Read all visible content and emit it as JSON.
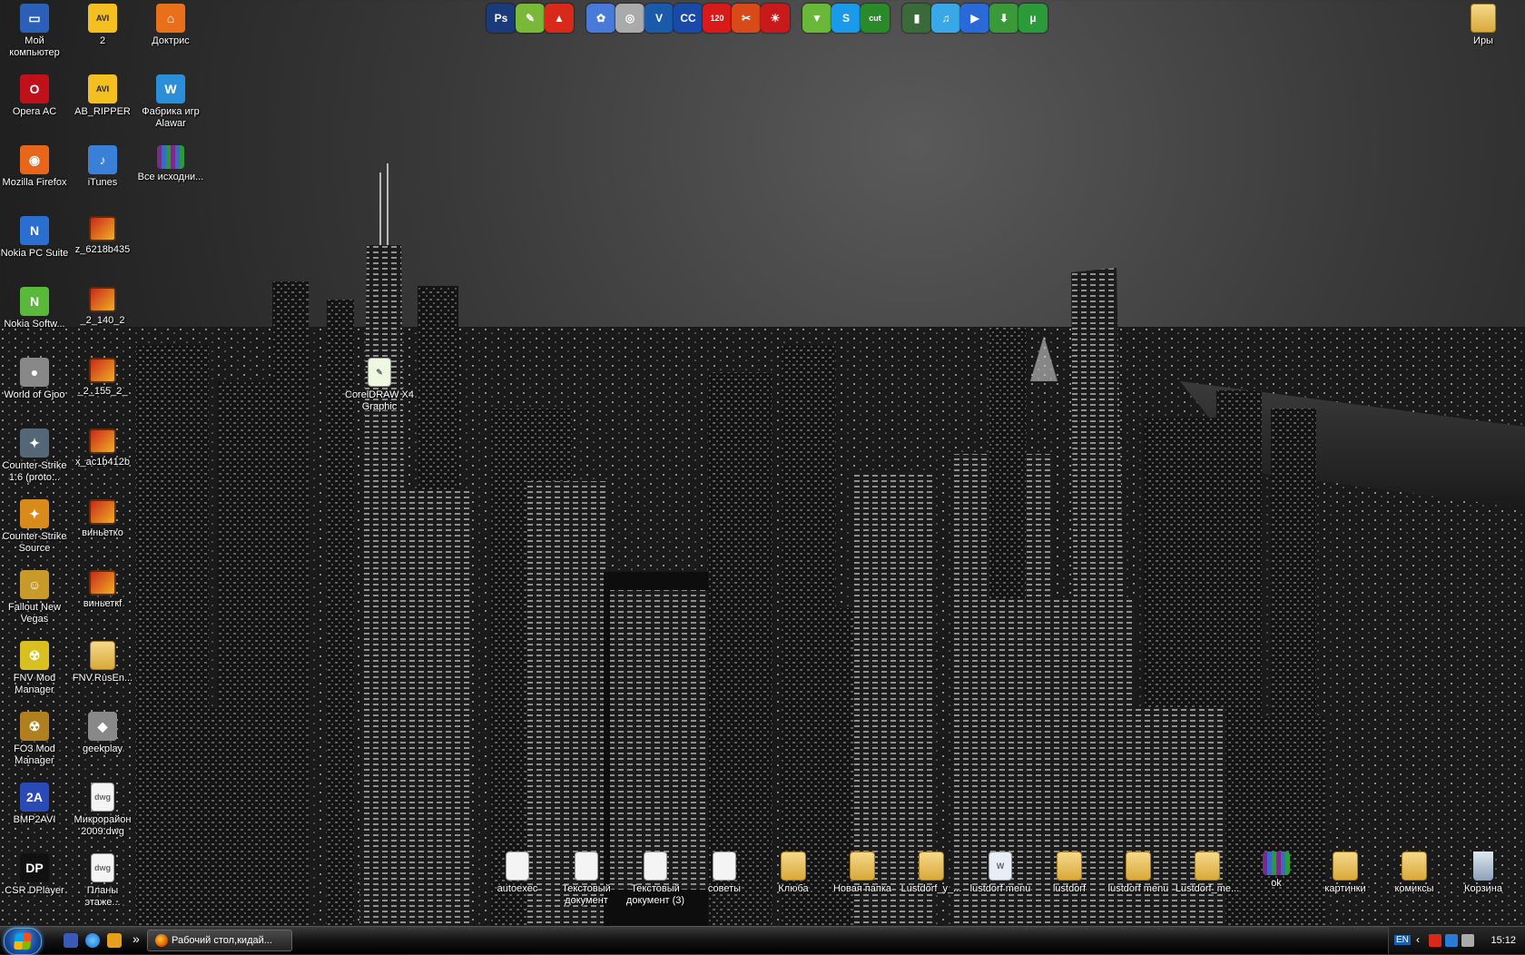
{
  "desktop": {
    "left_icons": [
      {
        "label": "Мой компьютер",
        "icon": "my-computer-icon",
        "color": "#2b5fb8",
        "glyph": "▭"
      },
      {
        "label": "2",
        "icon": "avi-file-icon",
        "color": "#d9a300",
        "glyph": "AVI"
      },
      {
        "label": "Доктрис",
        "icon": "doctris-app-icon",
        "color": "#e8701a",
        "glyph": "⌂"
      },
      {
        "label": "Opera AC",
        "icon": "opera-icon",
        "color": "#c0101a",
        "glyph": "O"
      },
      {
        "label": "AB_RIPPER",
        "icon": "avi-file-icon",
        "color": "#d9a300",
        "glyph": "AVI"
      },
      {
        "label": "Фабрика игр Alawar",
        "icon": "alawar-icon",
        "color": "#2a8fd8",
        "glyph": "W"
      },
      {
        "label": "Mozilla Firefox",
        "icon": "firefox-icon",
        "color": "#e8661a",
        "glyph": "◉"
      },
      {
        "label": "iTunes",
        "icon": "itunes-icon",
        "color": "#3a7fd8",
        "glyph": "♪"
      },
      {
        "label": "Все исходни...",
        "icon": "rar-archive-icon",
        "color": "#7b2a8c",
        "glyph": ""
      },
      {
        "label": "Nokia PC Suite",
        "icon": "nokia-pc-suite-icon",
        "color": "#2a6fd0",
        "glyph": "N"
      },
      {
        "label": "z_6218b435",
        "icon": "image-file-icon",
        "color": "#c8291c",
        "glyph": ""
      },
      {
        "label": "Nokia Softw...",
        "icon": "nokia-software-icon",
        "color": "#5ab83a",
        "glyph": "N"
      },
      {
        "label": "_2_140_2",
        "icon": "image-file-icon",
        "color": "#c8291c",
        "glyph": ""
      },
      {
        "label": "World of Gjoo",
        "icon": "world-of-goo-icon",
        "color": "#888888",
        "glyph": "●"
      },
      {
        "label": "_2_155_2_",
        "icon": "image-file-icon",
        "color": "#c8291c",
        "glyph": ""
      },
      {
        "label": "Counter-Strike 1.6 (proto...",
        "icon": "counter-strike-icon",
        "color": "#556677",
        "glyph": "✦"
      },
      {
        "label": "x_ac1b412b",
        "icon": "image-file-icon",
        "color": "#c8291c",
        "glyph": ""
      },
      {
        "label": "Counter-Strike Source",
        "icon": "counter-strike-source-icon",
        "color": "#d88a1a",
        "glyph": "✦"
      },
      {
        "label": "виньетко",
        "icon": "image-file-icon",
        "color": "#c8291c",
        "glyph": ""
      },
      {
        "label": "Fallout New Vegas",
        "icon": "fallout-icon",
        "color": "#c89a2a",
        "glyph": "☺"
      },
      {
        "label": "виньеткf",
        "icon": "image-file-icon",
        "color": "#c8291c",
        "glyph": ""
      },
      {
        "label": "FNV Mod Manager",
        "icon": "fnv-mod-manager-icon",
        "color": "#d8c020",
        "glyph": "☢"
      },
      {
        "label": "FNV.RusEn...",
        "icon": "folder-icon",
        "color": "#d9a93a",
        "glyph": ""
      },
      {
        "label": "FO3 Mod Manager",
        "icon": "fo3-mod-manager-icon",
        "color": "#b08020",
        "glyph": "☢"
      },
      {
        "label": "geekplay",
        "icon": "geekplay-icon",
        "color": "#888888",
        "glyph": "◆"
      },
      {
        "label": "BMP2AVI",
        "icon": "bmp2avi-icon",
        "color": "#2a4ab8",
        "glyph": "2A"
      },
      {
        "label": "Микрорайон 2009.dwg",
        "icon": "dwg-file-icon",
        "color": "#f4f4f4",
        "glyph": "dwg"
      },
      {
        "label": "CSR DPlayer",
        "icon": "csr-dplayer-icon",
        "color": "#111111",
        "glyph": "DP"
      },
      {
        "label": "Планы этаже...",
        "icon": "dwg-file-icon",
        "color": "#f4f4f4",
        "glyph": "dwg"
      }
    ],
    "middle_icon": {
      "label": "CorelDRAW X4 Graphic",
      "icon": "coreldraw-file-icon"
    },
    "top_right_icon": {
      "label": "Иры",
      "icon": "folder-icon"
    },
    "bottom_icons": [
      {
        "label": "autoexec",
        "icon": "system-file-icon",
        "kind": "doc"
      },
      {
        "label": "Текстовый документ",
        "icon": "text-document-icon",
        "kind": "doc"
      },
      {
        "label": "Текстовый документ (3)",
        "icon": "text-document-icon",
        "kind": "doc"
      },
      {
        "label": "советы",
        "icon": "text-document-icon",
        "kind": "doc"
      },
      {
        "label": "Клюба",
        "icon": "folder-icon",
        "kind": "folder"
      },
      {
        "label": "Новая папка",
        "icon": "folder-icon",
        "kind": "folder"
      },
      {
        "label": "Lustdorf_у_...",
        "icon": "folder-icon",
        "kind": "folder"
      },
      {
        "label": "lustdorf menu",
        "icon": "word-document-icon",
        "kind": "doc"
      },
      {
        "label": "lustdorf",
        "icon": "folder-icon",
        "kind": "folder"
      },
      {
        "label": "lustdorf menu",
        "icon": "folder-icon",
        "kind": "folder"
      },
      {
        "label": "Lustdorf_me...",
        "icon": "folder-icon",
        "kind": "folder"
      },
      {
        "label": "ok",
        "icon": "rar-archive-icon",
        "kind": "rar"
      },
      {
        "label": "картинки",
        "icon": "folder-icon",
        "kind": "folder"
      },
      {
        "label": "комиксы",
        "icon": "folder-icon",
        "kind": "folder"
      },
      {
        "label": "Корзина",
        "icon": "recycle-bin-icon",
        "kind": "bin"
      }
    ]
  },
  "quickbar": [
    {
      "icon": "photoshop-icon",
      "color": "#1a3a7a",
      "glyph": "Ps"
    },
    {
      "icon": "coreldraw-icon",
      "color": "#7ab83a",
      "glyph": "✎"
    },
    {
      "icon": "acrobat-icon",
      "color": "#d82a1a",
      "glyph": "▲"
    },
    {
      "icon": "paint-icon",
      "color": "#4a7ad8",
      "glyph": "✿"
    },
    {
      "icon": "disc-icon",
      "color": "#aaaaaa",
      "glyph": "◎"
    },
    {
      "icon": "vso-icon",
      "color": "#1a5aa8",
      "glyph": "V"
    },
    {
      "icon": "cc-icon",
      "color": "#1a4aa8",
      "glyph": "CC"
    },
    {
      "icon": "alcohol-120-icon",
      "color": "#d81a1a",
      "glyph": "120"
    },
    {
      "icon": "tools-icon",
      "color": "#d84a1a",
      "glyph": "✂"
    },
    {
      "icon": "burn-icon",
      "color": "#c81a1a",
      "glyph": "☀"
    },
    {
      "icon": "winamp-icon",
      "color": "#6ab83a",
      "glyph": "▼"
    },
    {
      "icon": "skype-icon",
      "color": "#1a9ae8",
      "glyph": "S"
    },
    {
      "icon": "mp3-directcut-icon",
      "color": "#2a8a2a",
      "glyph": "cut"
    },
    {
      "icon": "nokia-phone-icon",
      "color": "#3a6a3a",
      "glyph": "▮"
    },
    {
      "icon": "music-icon",
      "color": "#3aa8e8",
      "glyph": "♫"
    },
    {
      "icon": "kmplayer-icon",
      "color": "#2a6ad8",
      "glyph": "▶"
    },
    {
      "icon": "download-icon",
      "color": "#3a9a3a",
      "glyph": "⬇"
    },
    {
      "icon": "utorrent-icon",
      "color": "#2a9a3a",
      "glyph": "µ"
    }
  ],
  "taskbar": {
    "task_label": "Рабочий стол,кидай...",
    "more_glyph": "»",
    "tray": {
      "lang": "EN",
      "time": "15:12"
    }
  }
}
